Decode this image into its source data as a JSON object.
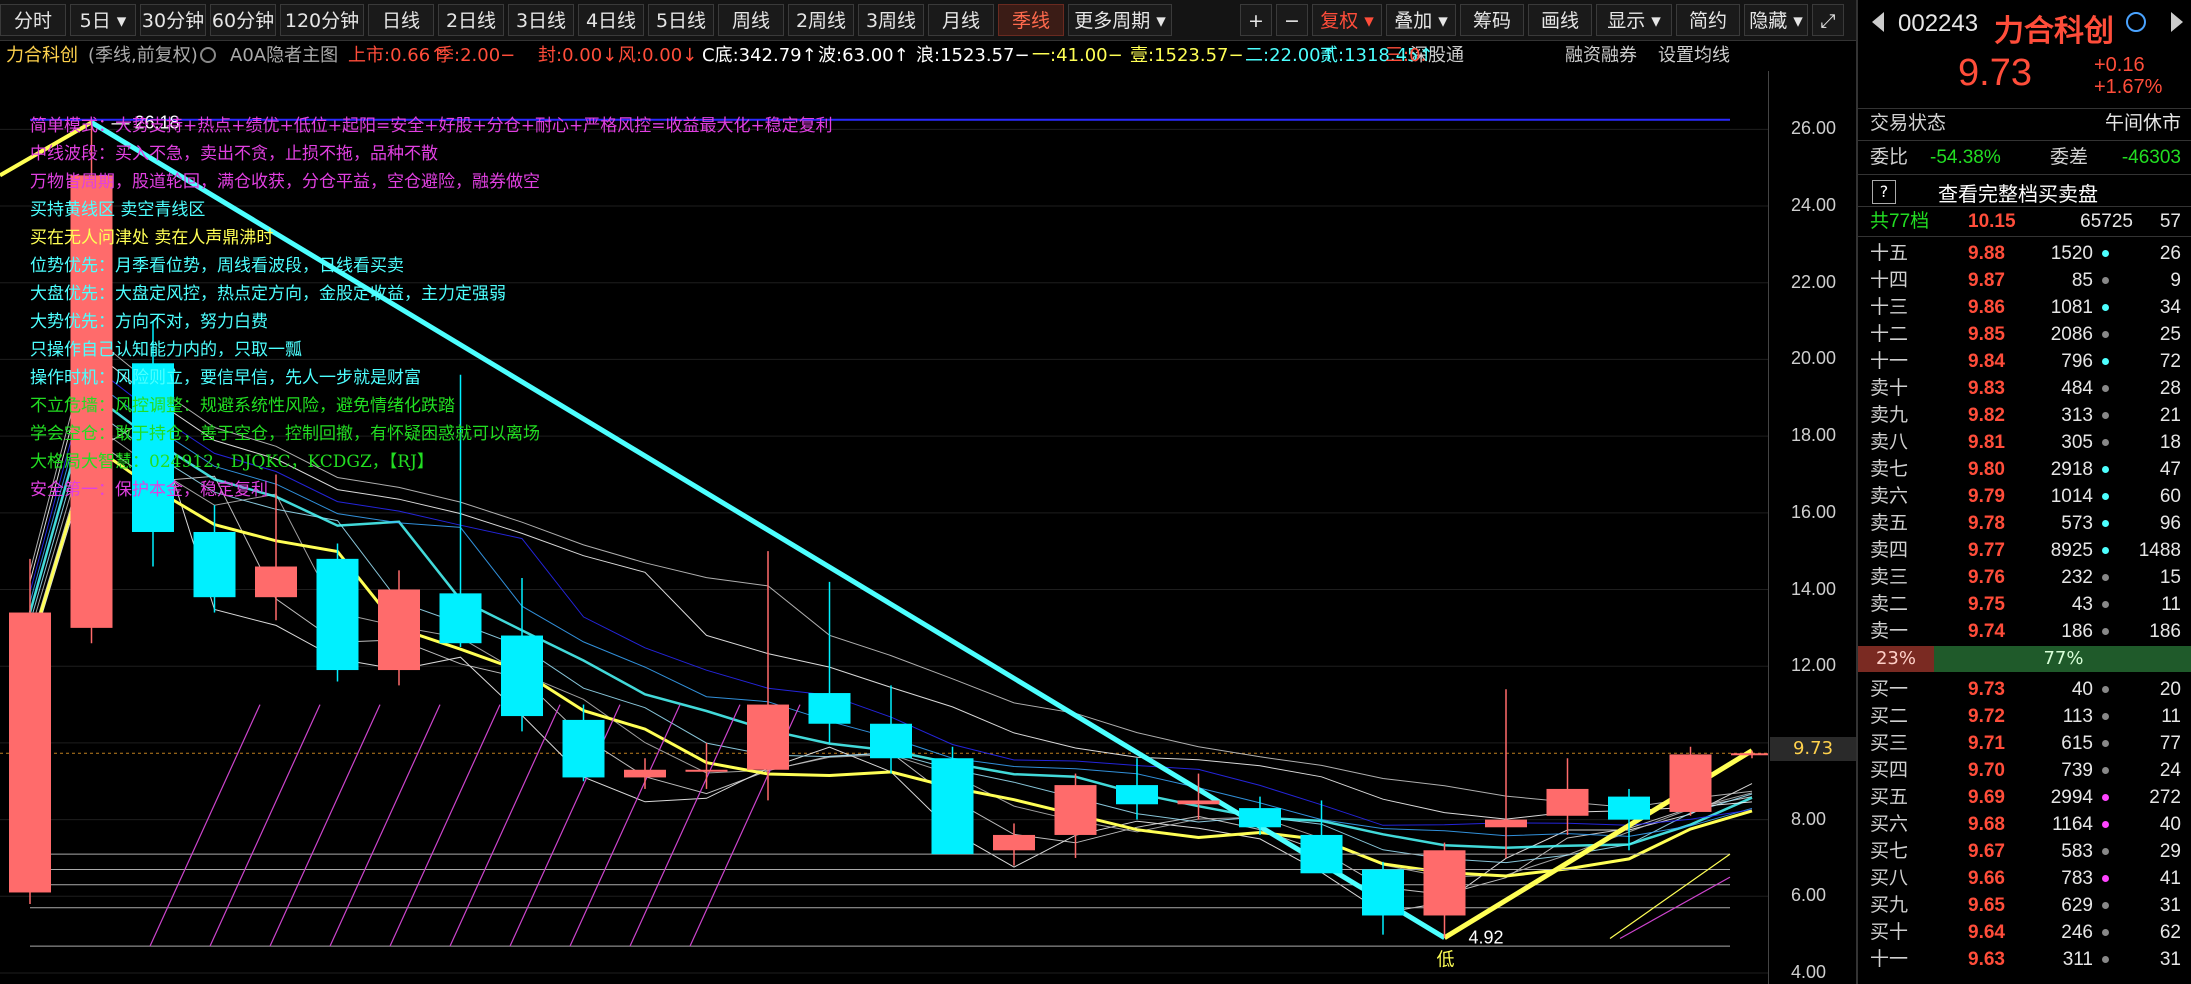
{
  "toolbar": {
    "periods": [
      "分时",
      "5日",
      "30分钟",
      "60分钟",
      "120分钟",
      "日线",
      "2日线",
      "3日线",
      "4日线",
      "5日线",
      "周线",
      "2周线",
      "3周线",
      "月线",
      "季线",
      "更多周期"
    ],
    "active_period": "季线",
    "plus": "+",
    "minus": "−",
    "fuquan": "复权",
    "overlay": "叠加",
    "chip": "筹码",
    "draw": "画线",
    "display": "显示",
    "simple": "简约",
    "hide": "隐藏"
  },
  "infobar": {
    "stock": "力合科创",
    "mode": "(季线,前复权)",
    "indicator": "A0A隐者主图",
    "items": [
      {
        "text": "上市:0.66↑",
        "color": "#ff4d3a"
      },
      {
        "text": "季:2.00−",
        "color": "#ff4d3a"
      },
      {
        "text": "封:0.00↓",
        "color": "#ff4d3a"
      },
      {
        "text": "风:0.00↓",
        "color": "#ff4d3a"
      },
      {
        "text": "C底:342.79↑",
        "color": "#ffffff"
      },
      {
        "text": "波:63.00↑",
        "color": "#ffffff"
      },
      {
        "text": "浪:1523.57−",
        "color": "#ffffff"
      },
      {
        "text": "一:41.00−",
        "color": "#ffff55"
      },
      {
        "text": "壹:1523.57−",
        "color": "#ffff55"
      },
      {
        "text": "二:22.00↑",
        "color": "#4dffff"
      },
      {
        "text": "贰:1318.45↑",
        "color": "#4dffff"
      },
      {
        "text": "三:0.",
        "color": "#ff4d3a"
      }
    ],
    "links": [
      "深股通",
      "融资融券",
      "设置均线"
    ]
  },
  "notes": [
    {
      "text": "简单模式：大势支持+热点+绩优+低位+起阳=安全+好股+分仓+耐心+严格风控=收益最大化+稳定复利",
      "color": "#e040e0"
    },
    {
      "text": "中线波段：买入不急，卖出不贪，止损不拖，品种不散",
      "color": "#e040e0"
    },
    {
      "text": "万物皆周期，股道轮回，满仓收获，分仓平益，空仓避险，融券做空",
      "color": "#e040e0"
    },
    {
      "text": "买持黄线区    卖空青线区",
      "color": "#4dffff"
    },
    {
      "text": "买在无人问津处 卖在人声鼎沸时",
      "color": "#ffff55"
    },
    {
      "text": "位势优先：月季看位势，周线看波段，日线看买卖",
      "color": "#4dffff"
    },
    {
      "text": "大盘优先：大盘定风控，热点定方向，金股定收益，主力定强弱",
      "color": "#4dffff"
    },
    {
      "text": "大势优先：方向不对，努力白费",
      "color": "#4dffff"
    },
    {
      "text": "只操作自己认知能力内的，只取一瓢",
      "color": "#4dffff"
    },
    {
      "text": "操作时机：风险则立，要信早信，先人一步就是财富",
      "color": "#4dffff"
    },
    {
      "text": "不立危墙：风控调整：规避系统性风险，避免情绪化跌踏",
      "color": "#22dd22"
    },
    {
      "text": "学会空仓：敢于持仓，善于空仓，控制回撤，有怀疑困惑就可以离场",
      "color": "#22dd22"
    },
    {
      "text": "大格局大智慧：024912，DJQKC，KCDGZ，【RJ】",
      "color": "#22dd22"
    },
    {
      "text": "安全第一：保护本金，稳定复利",
      "color": "#e040e0"
    }
  ],
  "chart_data": {
    "type": "candlestick",
    "ylim": [
      4,
      27
    ],
    "yticks": [
      4,
      6,
      8,
      10,
      12,
      14,
      16,
      18,
      20,
      22,
      24,
      26
    ],
    "ytick_labels": [
      "4.00",
      "6.00",
      "8.00",
      "",
      "12.00",
      "14.00",
      "16.00",
      "18.00",
      "20.00",
      "22.00",
      "24.00",
      "26.00"
    ],
    "current_price": 9.73,
    "current_price_label": "9.73",
    "high_label": "26.18",
    "low_label": "4.92",
    "low_mark": "低",
    "candles": [
      {
        "o": 6.1,
        "h": 14.8,
        "l": 5.8,
        "c": 13.4
      },
      {
        "o": 13.0,
        "h": 26.18,
        "l": 12.6,
        "c": 24.8
      },
      {
        "o": 19.9,
        "h": 21.0,
        "l": 14.6,
        "c": 15.5
      },
      {
        "o": 15.5,
        "h": 16.2,
        "l": 13.4,
        "c": 13.8
      },
      {
        "o": 13.8,
        "h": 17.0,
        "l": 13.2,
        "c": 14.6
      },
      {
        "o": 14.8,
        "h": 15.2,
        "l": 11.6,
        "c": 11.9
      },
      {
        "o": 11.9,
        "h": 14.5,
        "l": 11.5,
        "c": 14.0
      },
      {
        "o": 13.9,
        "h": 19.6,
        "l": 12.5,
        "c": 12.6
      },
      {
        "o": 12.8,
        "h": 14.3,
        "l": 10.3,
        "c": 10.7
      },
      {
        "o": 10.6,
        "h": 11.0,
        "l": 9.0,
        "c": 9.1
      },
      {
        "o": 9.1,
        "h": 9.6,
        "l": 8.8,
        "c": 9.3
      },
      {
        "o": 9.3,
        "h": 10.0,
        "l": 8.8,
        "c": 9.3
      },
      {
        "o": 9.3,
        "h": 15.0,
        "l": 8.5,
        "c": 11.0
      },
      {
        "o": 11.3,
        "h": 14.2,
        "l": 10.0,
        "c": 10.5
      },
      {
        "o": 10.5,
        "h": 11.5,
        "l": 9.2,
        "c": 9.6
      },
      {
        "o": 9.6,
        "h": 9.9,
        "l": 7.5,
        "c": 7.1
      },
      {
        "o": 7.2,
        "h": 7.9,
        "l": 6.8,
        "c": 7.6
      },
      {
        "o": 7.6,
        "h": 9.2,
        "l": 7.0,
        "c": 8.9
      },
      {
        "o": 8.9,
        "h": 9.6,
        "l": 8.0,
        "c": 8.4
      },
      {
        "o": 8.4,
        "h": 9.2,
        "l": 8.0,
        "c": 8.5
      },
      {
        "o": 8.3,
        "h": 8.6,
        "l": 7.6,
        "c": 7.8
      },
      {
        "o": 7.6,
        "h": 8.5,
        "l": 6.7,
        "c": 6.6
      },
      {
        "o": 6.7,
        "h": 6.9,
        "l": 5.0,
        "c": 5.5
      },
      {
        "o": 5.5,
        "h": 7.4,
        "l": 4.92,
        "c": 7.2
      },
      {
        "o": 7.8,
        "h": 11.4,
        "l": 7.0,
        "c": 8.0
      },
      {
        "o": 8.1,
        "h": 9.6,
        "l": 7.6,
        "c": 8.8
      },
      {
        "o": 8.6,
        "h": 8.8,
        "l": 7.2,
        "c": 8.0
      },
      {
        "o": 8.2,
        "h": 9.9,
        "l": 8.1,
        "c": 9.7
      },
      {
        "o": 9.7,
        "h": 9.8,
        "l": 9.6,
        "c": 9.73
      }
    ]
  },
  "side": {
    "code": "002243",
    "name": "力合科创",
    "price": "9.73",
    "change": "+0.16",
    "change_pct": "+1.67%",
    "status_label": "交易状态",
    "status_value": "午间休市",
    "weibi_label": "委比",
    "weibi_value": "-54.38%",
    "weicha_label": "委差",
    "weicha_value": "-46303",
    "full_book": "查看完整档买卖盘",
    "total_label": "共77档",
    "total_price": "10.15",
    "total_vol": "65725",
    "total_cnt": "57",
    "sell": [
      {
        "label": "十五",
        "price": "9.88",
        "vol": "1520",
        "cnt": "26",
        "dot": "#4dffff"
      },
      {
        "label": "十四",
        "price": "9.87",
        "vol": "85",
        "cnt": "9",
        "dot": "#888888"
      },
      {
        "label": "十三",
        "price": "9.86",
        "vol": "1081",
        "cnt": "34",
        "dot": "#4dffff"
      },
      {
        "label": "十二",
        "price": "9.85",
        "vol": "2086",
        "cnt": "25",
        "dot": "#888888"
      },
      {
        "label": "十一",
        "price": "9.84",
        "vol": "796",
        "cnt": "72",
        "dot": "#4dffff"
      },
      {
        "label": "卖十",
        "price": "9.83",
        "vol": "484",
        "cnt": "28",
        "dot": "#888888"
      },
      {
        "label": "卖九",
        "price": "9.82",
        "vol": "313",
        "cnt": "21",
        "dot": "#888888"
      },
      {
        "label": "卖八",
        "price": "9.81",
        "vol": "305",
        "cnt": "18",
        "dot": "#888888"
      },
      {
        "label": "卖七",
        "price": "9.80",
        "vol": "2918",
        "cnt": "47",
        "dot": "#4dffff"
      },
      {
        "label": "卖六",
        "price": "9.79",
        "vol": "1014",
        "cnt": "60",
        "dot": "#4dffff"
      },
      {
        "label": "卖五",
        "price": "9.78",
        "vol": "573",
        "cnt": "96",
        "dot": "#4dffff"
      },
      {
        "label": "卖四",
        "price": "9.77",
        "vol": "8925",
        "cnt": "1488",
        "dot": "#4dffff"
      },
      {
        "label": "卖三",
        "price": "9.76",
        "vol": "232",
        "cnt": "15",
        "dot": "#888888"
      },
      {
        "label": "卖二",
        "price": "9.75",
        "vol": "43",
        "cnt": "11",
        "dot": "#888888"
      },
      {
        "label": "卖一",
        "price": "9.74",
        "vol": "186",
        "cnt": "186",
        "dot": "#888888"
      }
    ],
    "ratio_sell": "23%",
    "ratio_buy": "77%",
    "buy": [
      {
        "label": "买一",
        "price": "9.73",
        "vol": "40",
        "cnt": "20",
        "dot": "#888888"
      },
      {
        "label": "买二",
        "price": "9.72",
        "vol": "113",
        "cnt": "11",
        "dot": "#888888"
      },
      {
        "label": "买三",
        "price": "9.71",
        "vol": "615",
        "cnt": "77",
        "dot": "#888888"
      },
      {
        "label": "买四",
        "price": "9.70",
        "vol": "739",
        "cnt": "24",
        "dot": "#888888"
      },
      {
        "label": "买五",
        "price": "9.69",
        "vol": "2994",
        "cnt": "272",
        "dot": "#ff44ff"
      },
      {
        "label": "买六",
        "price": "9.68",
        "vol": "1164",
        "cnt": "40",
        "dot": "#ff44ff"
      },
      {
        "label": "买七",
        "price": "9.67",
        "vol": "583",
        "cnt": "29",
        "dot": "#888888"
      },
      {
        "label": "买八",
        "price": "9.66",
        "vol": "783",
        "cnt": "41",
        "dot": "#ff44ff"
      },
      {
        "label": "买九",
        "price": "9.65",
        "vol": "629",
        "cnt": "31",
        "dot": "#888888"
      },
      {
        "label": "买十",
        "price": "9.64",
        "vol": "246",
        "cnt": "62",
        "dot": "#888888"
      },
      {
        "label": "十一",
        "price": "9.63",
        "vol": "311",
        "cnt": "31",
        "dot": "#888888"
      }
    ]
  }
}
